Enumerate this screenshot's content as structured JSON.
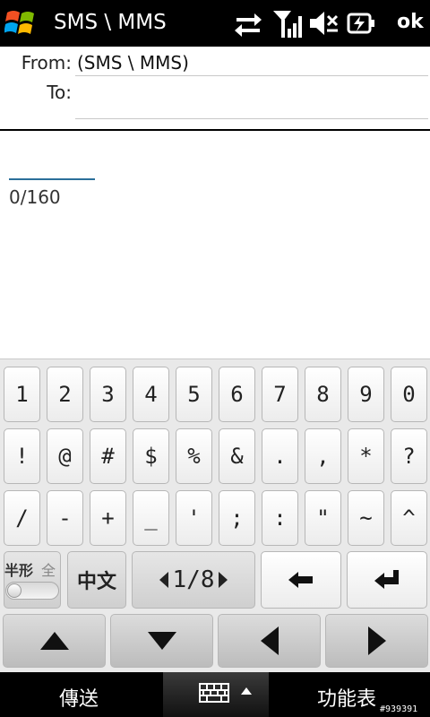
{
  "titlebar": {
    "app_title": "SMS \\ MMS",
    "ok_label": "ok",
    "icons": [
      "windows-start-icon",
      "data-sync-icon",
      "signal-strength-icon",
      "speaker-mute-icon",
      "battery-charging-icon"
    ]
  },
  "header": {
    "from_label": "From:",
    "from_value": "(SMS \\ MMS)",
    "to_label": "To:",
    "to_value": ""
  },
  "body": {
    "message_text": "",
    "char_count": "0/160"
  },
  "keyboard": {
    "row1": [
      "1",
      "2",
      "3",
      "4",
      "5",
      "6",
      "7",
      "8",
      "9",
      "0"
    ],
    "row2": [
      "!",
      "@",
      "#",
      "$",
      "%",
      "&",
      ".",
      ",",
      "*",
      "?"
    ],
    "row3": [
      "/",
      "-",
      "+",
      "_",
      "'",
      ";",
      ":",
      "\"",
      "~",
      "^"
    ],
    "mode_half": "半形",
    "mode_full": "全",
    "chinese_label": "中文",
    "page_indicator": "1/8"
  },
  "softkeys": {
    "left": "傳送",
    "right": "功能表"
  },
  "watermark": "#939391",
  "colors": {
    "titlebar_bg": "#000000",
    "input_underline": "#2b6f9a",
    "keyboard_bg": "#e9e9e9"
  }
}
